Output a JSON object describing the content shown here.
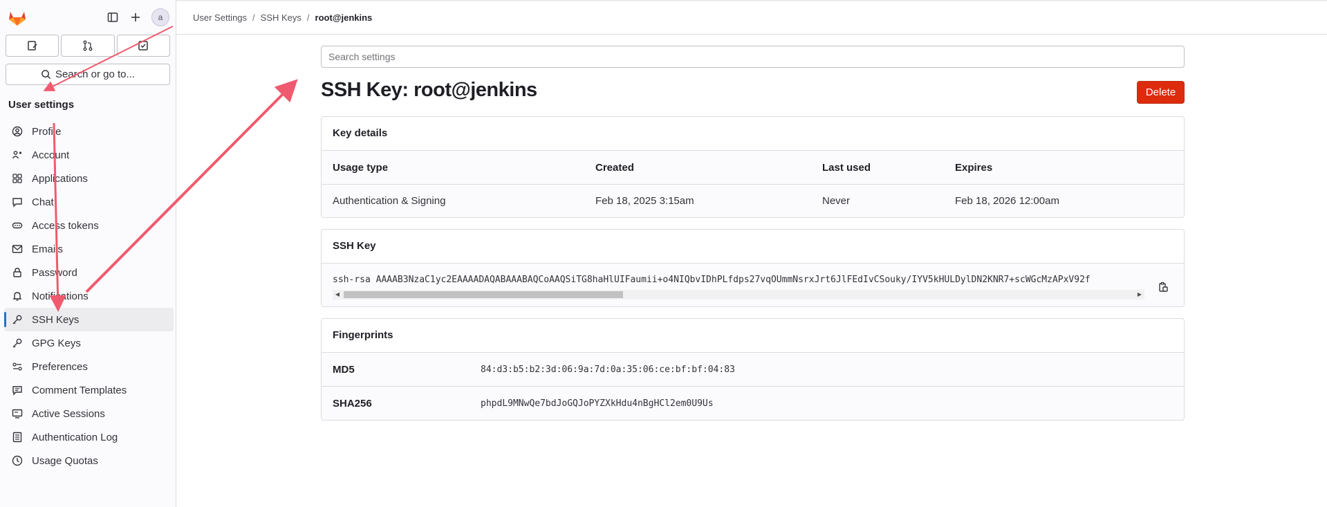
{
  "sidebar": {
    "avatar_alt": "a",
    "search_label": "Search or go to...",
    "section_title": "User settings",
    "items": [
      {
        "label": "Profile",
        "icon": "profile-icon"
      },
      {
        "label": "Account",
        "icon": "account-icon"
      },
      {
        "label": "Applications",
        "icon": "applications-icon"
      },
      {
        "label": "Chat",
        "icon": "chat-icon"
      },
      {
        "label": "Access tokens",
        "icon": "token-icon"
      },
      {
        "label": "Emails",
        "icon": "mail-icon"
      },
      {
        "label": "Password",
        "icon": "lock-icon"
      },
      {
        "label": "Notifications",
        "icon": "bell-icon"
      },
      {
        "label": "SSH Keys",
        "icon": "key-icon",
        "active": true
      },
      {
        "label": "GPG Keys",
        "icon": "key-icon"
      },
      {
        "label": "Preferences",
        "icon": "preferences-icon"
      },
      {
        "label": "Comment Templates",
        "icon": "comment-icon"
      },
      {
        "label": "Active Sessions",
        "icon": "monitor-icon"
      },
      {
        "label": "Authentication Log",
        "icon": "log-icon"
      },
      {
        "label": "Usage Quotas",
        "icon": "quota-icon"
      }
    ]
  },
  "breadcrumb": {
    "items": [
      "User Settings",
      "SSH Keys",
      "root@jenkins"
    ]
  },
  "main": {
    "search_placeholder": "Search settings",
    "title": "SSH Key: root@jenkins",
    "delete_label": "Delete",
    "key_details": {
      "heading": "Key details",
      "columns": [
        "Usage type",
        "Created",
        "Last used",
        "Expires"
      ],
      "row": [
        "Authentication & Signing",
        "Feb 18, 2025 3:15am",
        "Never",
        "Feb 18, 2026 12:00am"
      ]
    },
    "ssh_key": {
      "heading": "SSH Key",
      "value": "ssh-rsa AAAAB3NzaC1yc2EAAAADAQABAAABAQCoAAQSiTG8haHlUIFaumii+o4NIQbvIDhPLfdps27vqOUmmNsrxJrt6JlFEdIvCSouky/IYV5kHULDylDN2KNR7+scWGcMzAPxV92f"
    },
    "fingerprints": {
      "heading": "Fingerprints",
      "rows": [
        {
          "label": "MD5",
          "value": "84:d3:b5:b2:3d:06:9a:7d:0a:35:06:ce:bf:bf:04:83"
        },
        {
          "label": "SHA256",
          "value": "phpdL9MNwQe7bdJoGQJoPYZXkHdu4nBgHCl2em0U9Us"
        }
      ]
    }
  },
  "colors": {
    "accent": "#1f75cb",
    "danger": "#dd2b0e",
    "annotation_arrow": "#f05a6e"
  }
}
